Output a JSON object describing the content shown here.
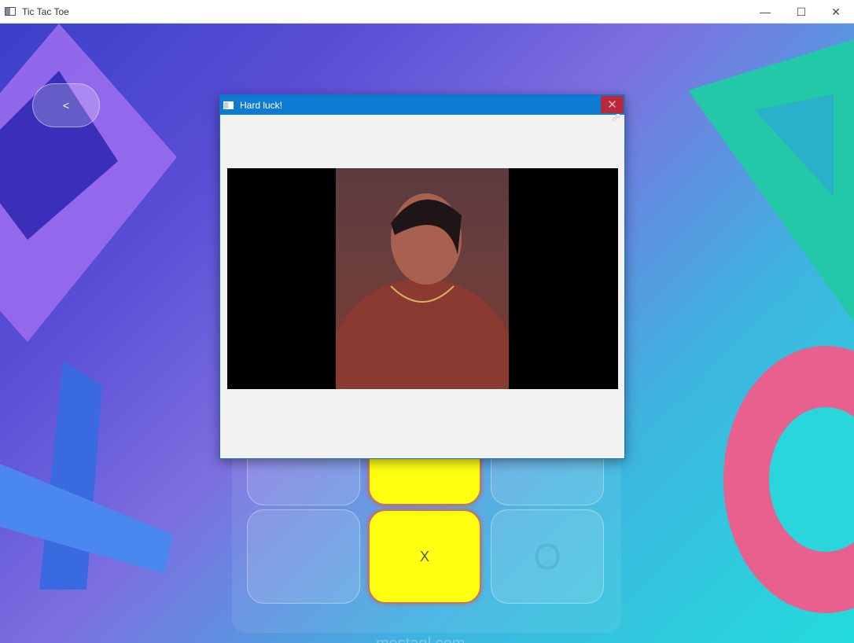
{
  "window": {
    "title": "Tic Tac Toe",
    "minimize_icon": "minimize-icon",
    "maximize_icon": "maximize-icon",
    "close_icon": "close-icon"
  },
  "back_button": {
    "label": "<"
  },
  "board": {
    "cells": [
      "",
      "",
      "",
      "",
      "X",
      "O"
    ],
    "winning_color": "#ffff10"
  },
  "dialog": {
    "title": "Hard luck!",
    "close_label": "✕"
  },
  "watermark": {
    "text": "mostaql.com"
  }
}
